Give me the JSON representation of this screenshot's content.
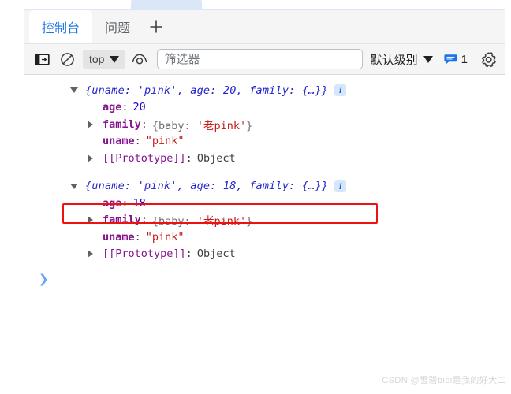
{
  "window": {
    "watermark": "CSDN @雪碧bibi是我的好大二"
  },
  "tabs": [
    {
      "label": "控制台",
      "active": true,
      "name": "tab-console"
    },
    {
      "label": "问题",
      "active": false,
      "name": "tab-issues"
    }
  ],
  "tab_add": {
    "label": "+",
    "icon": "plus-icon"
  },
  "toolbar": {
    "sidebar_toggle_icon": "sidebar-panel-icon",
    "clear_console_icon": "clear-console-icon",
    "context_selector": {
      "value": "top",
      "caret": "▼"
    },
    "live_expression_icon": "eye-icon",
    "filter": {
      "value": "",
      "placeholder": "筛选器"
    },
    "level_selector": {
      "value": "默认级别",
      "caret": "▼"
    },
    "message_badge": {
      "icon": "message-bubble-icon",
      "count": "1"
    },
    "settings_icon": "gear-icon"
  },
  "console": {
    "groups": [
      {
        "name": "log-entry-1",
        "expanded": true,
        "preview": "{uname: 'pink', age: 20, family: {…}}",
        "info_badge": "i",
        "properties": [
          {
            "twisty": "none",
            "key": "age",
            "key_type": "own",
            "value": "20",
            "value_type": "number"
          },
          {
            "twisty": "right",
            "key": "family",
            "key_type": "own",
            "value": "{baby: '老pink'}",
            "value_type": "object-preview",
            "inner_prefix": "{baby: ",
            "inner_string": "'老pink'",
            "inner_suffix": "}"
          },
          {
            "twisty": "none",
            "key": "uname",
            "key_type": "own",
            "value": "\"pink\"",
            "value_type": "string"
          },
          {
            "twisty": "right",
            "key": "[[Prototype]]",
            "key_type": "proto",
            "value": "Object",
            "value_type": "object"
          }
        ]
      },
      {
        "name": "log-entry-2",
        "expanded": true,
        "preview": "{uname: 'pink', age: 18, family: {…}}",
        "info_badge": "i",
        "properties": [
          {
            "twisty": "none",
            "key": "age",
            "key_type": "own",
            "value": "18",
            "value_type": "number"
          },
          {
            "twisty": "right",
            "key": "family",
            "key_type": "own",
            "value": "{baby: '老pink'}",
            "value_type": "object-preview",
            "inner_prefix": "{baby: ",
            "inner_string": "'老pink'",
            "inner_suffix": "}",
            "highlighted": true
          },
          {
            "twisty": "none",
            "key": "uname",
            "key_type": "own",
            "value": "\"pink\"",
            "value_type": "string"
          },
          {
            "twisty": "right",
            "key": "[[Prototype]]",
            "key_type": "proto",
            "value": "Object",
            "value_type": "object"
          }
        ]
      }
    ],
    "prompt": {
      "chevron": "❯"
    }
  },
  "colors": {
    "accent_blue": "#1a73e8",
    "annotation_red": "#ee1111",
    "key_purple": "#881391",
    "string_red": "#c41a16",
    "number_blue": "#1c00cf",
    "preview_blue": "#2525cc"
  }
}
